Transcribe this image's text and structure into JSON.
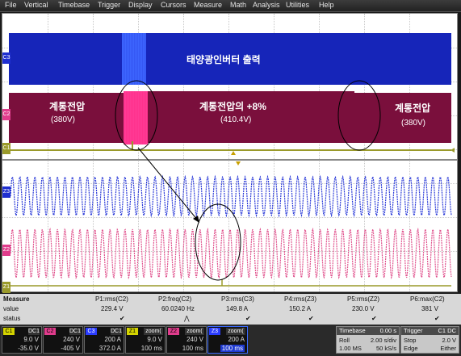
{
  "menu": [
    "File",
    "Vertical",
    "Timebase",
    "Trigger",
    "Display",
    "Cursors",
    "Measure",
    "Math",
    "Analysis",
    "Utilities",
    "Help"
  ],
  "channels": {
    "c3_tag": "C3",
    "c2_tag": "C2",
    "c1_tag": "C1",
    "z1_tag": "Z1",
    "z2_tag": "Z2",
    "z3_tag": "Z3"
  },
  "annotations": {
    "inverter_output": "태양광인버터 출력",
    "grid_left": "계통전압",
    "grid_left_v": "(380V)",
    "grid_mid": "계통전압의 +8%",
    "grid_mid_v": "(410.4V)",
    "grid_right": "계통전압",
    "grid_right_v": "(380V)"
  },
  "measure": {
    "row_labels": [
      "Measure",
      "value",
      "status"
    ],
    "params": [
      {
        "name": "P1:rms(C2)",
        "value": "229.4 V",
        "status": "✔"
      },
      {
        "name": "P2:freq(C2)",
        "value": "60.0240 Hz",
        "status": "⋀"
      },
      {
        "name": "P3:rms(C3)",
        "value": "149.8 A",
        "status": "✔"
      },
      {
        "name": "P4:rms(Z3)",
        "value": "150.2 A",
        "status": "✔"
      },
      {
        "name": "P5:rms(Z2)",
        "value": "230.0 V",
        "status": "✔"
      },
      {
        "name": "P6:max(C2)",
        "value": "381 V",
        "status": "✔"
      }
    ]
  },
  "chboxes": [
    {
      "tag": "C1",
      "icon": "DC1",
      "v1": "9.0 V",
      "v2": "-35.0 V",
      "color": "#d4d400"
    },
    {
      "tag": "C2",
      "icon": "DC1",
      "v1": "240 V",
      "v2": "-405 V",
      "color": "#e03c8c"
    },
    {
      "tag": "C3",
      "icon": "DC1",
      "v1": "200 A",
      "v2": "372.0 A",
      "color": "#2a3cff"
    },
    {
      "tag": "Z1",
      "icon": "zoom(",
      "v1": "9.0 V",
      "v2": "100 ms",
      "color": "#d4d400"
    },
    {
      "tag": "Z2",
      "icon": "zoom(",
      "v1": "240 V",
      "v2": "100 ms",
      "color": "#e03c8c"
    },
    {
      "tag": "Z3",
      "icon": "zoom(",
      "v1": "200 A",
      "v2": "100 ms",
      "color": "#2a3cff"
    }
  ],
  "timebase": {
    "header": "Timebase",
    "offset": "0.00 s",
    "mode": "Roll",
    "div": "2.00 s/div",
    "points": "1.00 MS",
    "rate": "50 kS/s"
  },
  "trigger": {
    "header": "Trigger",
    "tag": "C1 DC",
    "mode": "Stop",
    "level": "2.0 V",
    "type": "Edge",
    "slope": "Either"
  },
  "colors": {
    "blue": "#1f2fd0",
    "blue_band": "#0a1a8c",
    "maroon": "#7a0f3c",
    "pink_burst": "#ff2a8a",
    "olive": "#9a9a2a",
    "pink_wave": "#e0508c",
    "blue_wave": "#2838d8"
  }
}
